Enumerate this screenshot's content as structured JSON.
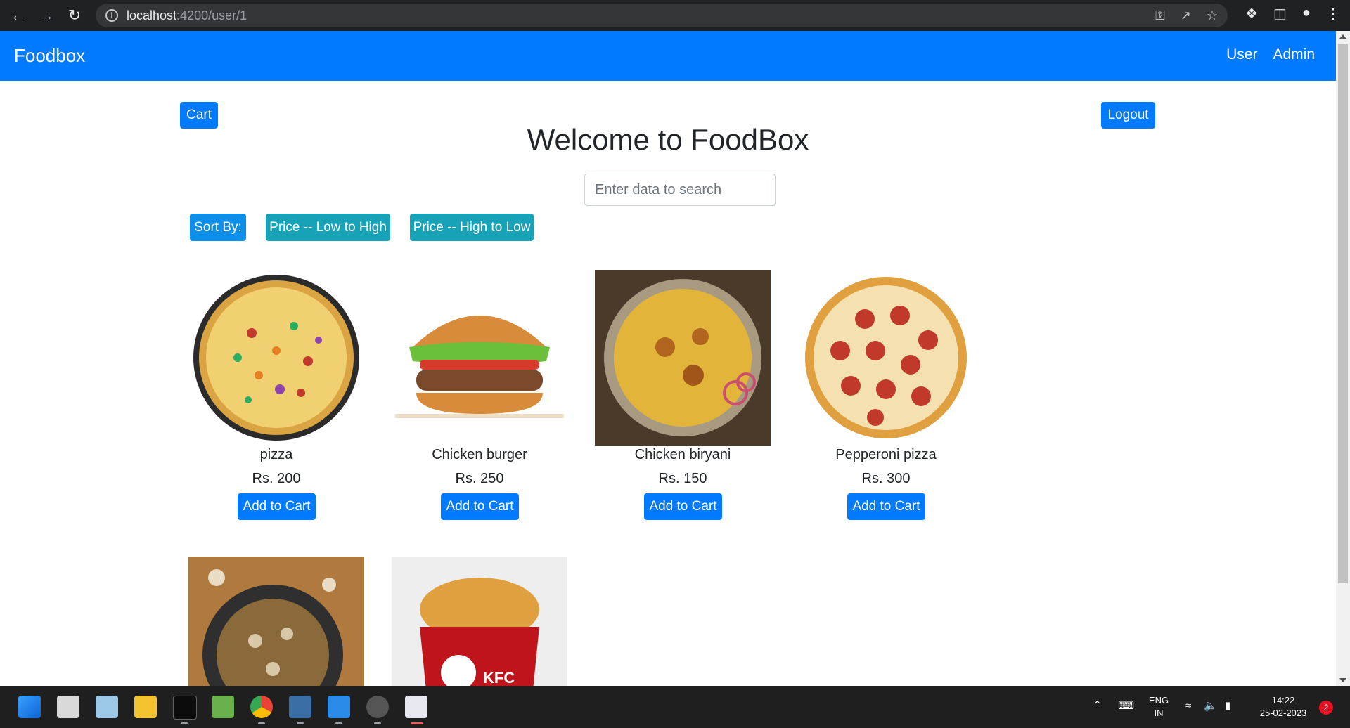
{
  "browser": {
    "url_host": "localhost",
    "url_path": ":4200/user/1"
  },
  "navbar": {
    "brand": "Foodbox",
    "links": [
      "User",
      "Admin"
    ]
  },
  "page": {
    "cart_label": "Cart",
    "logout_label": "Logout",
    "title": "Welcome to FoodBox",
    "search_placeholder": "Enter data to search",
    "sort_label": "Sort By:",
    "sort_low_high": "Price -- Low to High",
    "sort_high_low": "Price -- High to Low"
  },
  "products": [
    {
      "name": "pizza",
      "price": "Rs. 200",
      "button": "Add to Cart"
    },
    {
      "name": "Chicken burger",
      "price": "Rs. 250",
      "button": "Add to Cart"
    },
    {
      "name": "Chicken biryani",
      "price": "Rs. 150",
      "button": "Add to Cart"
    },
    {
      "name": "Pepperoni pizza",
      "price": "Rs. 300",
      "button": "Add to Cart"
    },
    {
      "name": "",
      "price": "",
      "button": ""
    },
    {
      "name": "",
      "price": "",
      "button": ""
    }
  ],
  "taskbar": {
    "lang_top": "ENG",
    "lang_bottom": "IN",
    "time": "14:22",
    "date": "25-02-2023",
    "notifications": "2"
  },
  "colors": {
    "primary": "#007bff",
    "info": "#17a2b8",
    "chrome_dark": "#202124"
  }
}
